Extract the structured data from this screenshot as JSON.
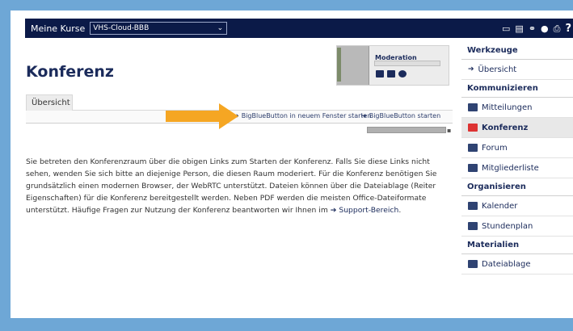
{
  "topbar": {
    "courses_label": "Meine Kurse",
    "course_select": "VHS-Cloud-BBB",
    "icons": [
      "chat-icon",
      "notes-icon",
      "link-icon",
      "location-icon",
      "print-icon",
      "help-icon"
    ],
    "help_glyph": "?"
  },
  "page": {
    "title": "Konferenz",
    "moderation_label": "Moderation"
  },
  "tabs": [
    {
      "label": "Übersicht"
    }
  ],
  "actions": {
    "open_new_window": "BigBlueButton in neuem Fenster starten",
    "start": "BigBlueButton starten"
  },
  "content": {
    "paragraph": "Sie betreten den Konferenzraum über die obigen Links zum Starten der Konferenz. Falls Sie diese Links nicht sehen, wenden Sie sich bitte an diejenige Person, die diesen Raum moderiert. Für die Konferenz benötigen Sie grundsätzlich einen modernen Browser, der WebRTC unterstützt. Dateien können über die Dateiablage (Reiter Eigenschaften) für die Konferenz bereitgestellt werden. Neben PDF werden die meisten Office-Dateiformate unterstützt. Häufige Fragen zur Nutzung der Konferenz beantworten wir Ihnen im",
    "support_link": "Support-Bereich",
    "period": "."
  },
  "sidebar": {
    "sections": [
      {
        "heading": "Werkzeuge",
        "items": [
          {
            "label": "Übersicht",
            "icon": "arrow-icon"
          }
        ]
      },
      {
        "heading": "Kommunizieren",
        "items": [
          {
            "label": "Mitteilungen",
            "icon": "messages-icon"
          },
          {
            "label": "Konferenz",
            "icon": "conference-icon",
            "active": true
          },
          {
            "label": "Forum",
            "icon": "forum-icon"
          },
          {
            "label": "Mitgliederliste",
            "icon": "members-icon"
          }
        ]
      },
      {
        "heading": "Organisieren",
        "items": [
          {
            "label": "Kalender",
            "icon": "calendar-icon"
          },
          {
            "label": "Stundenplan",
            "icon": "timetable-icon"
          }
        ]
      },
      {
        "heading": "Materialien",
        "items": [
          {
            "label": "Dateiablage",
            "icon": "files-icon"
          }
        ]
      }
    ]
  },
  "colors": {
    "frame": "#6ea7d6",
    "topbar": "#0b1a48",
    "accent_arrow": "#f5a623",
    "text_primary": "#1b2b5b",
    "conference_icon": "#dd3333"
  }
}
